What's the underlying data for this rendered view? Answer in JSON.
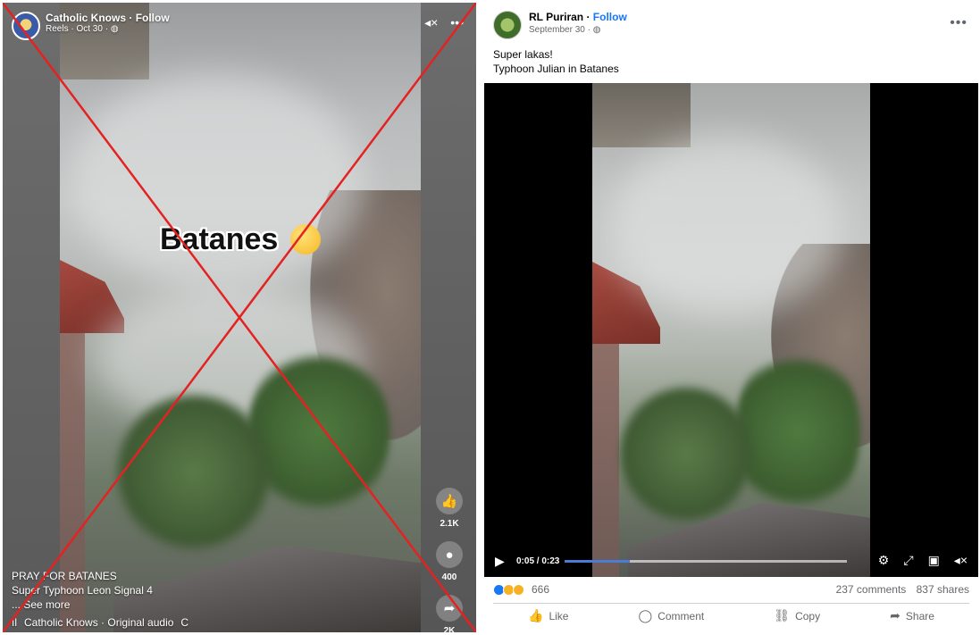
{
  "reel": {
    "author": "Catholic Knows",
    "follow_label": "Follow",
    "subline": "Reels · Oct 30 ·",
    "overlay_text": "Batanes",
    "likes": "2.1K",
    "comments": "400",
    "shares": "2K",
    "caption_line1": "PRAY FOR BATANES",
    "caption_line2": "Super Typhoon Leon Signal 4",
    "see_more": "... See more",
    "audio": "Catholic Knows · Original audio",
    "audio_extra": "C",
    "icons": {
      "mute": "speaker-muted-icon",
      "more": "more-dots-icon",
      "like": "thumbs-up-icon",
      "comment": "comment-bubble-icon",
      "share": "share-arrow-icon"
    }
  },
  "post": {
    "author": "RL Puriran",
    "follow_label": "Follow",
    "date": "September 30 ·",
    "text_line1": "Super lakas!",
    "text_line2": "Typhoon Julian in Batanes",
    "video": {
      "time": "0:05 / 0:23",
      "progress": 0.23
    },
    "reaction_count": "666",
    "comments": "237 comments",
    "shares": "837 shares",
    "actions": {
      "like": "Like",
      "comment": "Comment",
      "copy": "Copy",
      "share": "Share"
    }
  },
  "colors": {
    "accent": "#1877f2",
    "cross": "#e32222",
    "muted_text": "#65676b"
  }
}
